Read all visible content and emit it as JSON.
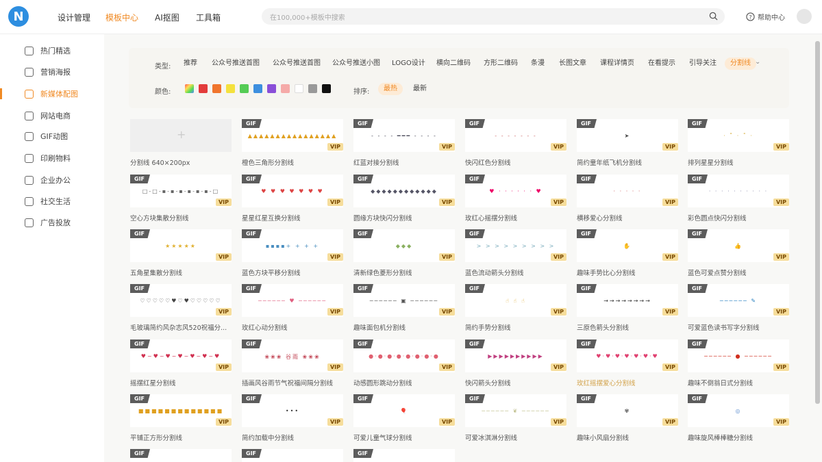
{
  "logo": {
    "letter": "N"
  },
  "nav": [
    {
      "label": "设计管理",
      "active": false
    },
    {
      "label": "模板中心",
      "active": true
    },
    {
      "label": "AI抠图",
      "active": false
    },
    {
      "label": "工具箱",
      "active": false
    }
  ],
  "search": {
    "placeholder": "在100,000+模板中搜索"
  },
  "help": {
    "label": "帮助中心"
  },
  "sidebar": [
    {
      "label": "热门精选",
      "icon": "flame-icon",
      "active": false
    },
    {
      "label": "营销海报",
      "icon": "poster-icon",
      "active": false
    },
    {
      "label": "新媒体配图",
      "icon": "chat-icon",
      "active": true
    },
    {
      "label": "网站电商",
      "icon": "store-icon",
      "active": false
    },
    {
      "label": "GIF动图",
      "icon": "gif-icon",
      "active": false
    },
    {
      "label": "印刷物料",
      "icon": "print-icon",
      "active": false
    },
    {
      "label": "企业办公",
      "icon": "briefcase-icon",
      "active": false
    },
    {
      "label": "社交生活",
      "icon": "cup-icon",
      "active": false
    },
    {
      "label": "广告投放",
      "icon": "ad-icon",
      "active": false
    }
  ],
  "filter": {
    "type_label": "类型:",
    "types": [
      "推荐",
      "公众号推送首图",
      "公众号推送首图",
      "公众号推送小图",
      "LOGO设计",
      "横向二维码",
      "方形二维码",
      "条漫",
      "长图文章",
      "课程详情页",
      "在看提示",
      "引导关注",
      "分割线"
    ],
    "selected_type": "分割线",
    "color_label": "颜色:",
    "colors": [
      "#6f6cf5",
      "#e33b3b",
      "#f0752d",
      "#f4e13d",
      "#55cc55",
      "#3d8fdf",
      "#8a4fd8",
      "#f5aaa8",
      "#ffffff",
      "#999999",
      "#111111"
    ],
    "sort_label": "排序:",
    "sorts": [
      "最热",
      "最新"
    ],
    "selected_sort": "最热"
  },
  "badges": {
    "gif": "GIF",
    "vip": "VIP"
  },
  "upload": {
    "label": "分割线 640×200px"
  },
  "templates": [
    {
      "title": "橙色三角形分割线",
      "deco": "▲▲▲▲▲▲▲▲▲▲▲▲▲▲▲▲",
      "color": "#e0a020"
    },
    {
      "title": "红蓝对接分割线",
      "deco": "- - - - ━━━ - - - -",
      "color": "#445"
    },
    {
      "title": "快闪红色分割线",
      "deco": "- - - - - - -",
      "color": "#c66"
    },
    {
      "title": "简约童年纸飞机分割线",
      "deco": "➤",
      "color": "#444"
    },
    {
      "title": "排列星星分割线",
      "deco": "· ˚ · ˚ ·",
      "color": "#d8b040"
    },
    {
      "title": "空心方块集散分割线",
      "deco": "□-□-▪-▪-▪-▪-▪-▪-□",
      "color": "#666"
    },
    {
      "title": "星星红星互换分割线",
      "deco": "♥ ♥ ♥ ♥ ♥ ♥ ♥",
      "color": "#d44"
    },
    {
      "title": "圆缘方块快闪分割线",
      "deco": "◆◆◆◆◆◆◆◆◆◆◆◆",
      "color": "#556"
    },
    {
      "title": "玫红心摇摆分割线",
      "deco": "♥ · · · · · · ♥",
      "color": "#e06"
    },
    {
      "title": "横移爱心分割线",
      "deco": "· · · · ·",
      "color": "#c55"
    },
    {
      "title": "彩色圆点快闪分割线",
      "deco": "· · · · · · · · · ·",
      "color": "#88a"
    },
    {
      "title": "五角星集散分割线",
      "deco": "★★★★★",
      "color": "#e0b030"
    },
    {
      "title": "蓝色方块平移分割线",
      "deco": "▪▪▪▪+ + +   +",
      "color": "#4a8fc0"
    },
    {
      "title": "清新绿色菱形分割线",
      "deco": "◆◆◆",
      "color": "#8ab060"
    },
    {
      "title": "蓝色流动箭头分割线",
      "deco": "> > > > > > > > >",
      "color": "#7ab"
    },
    {
      "title": "趣味手势比心分割线",
      "deco": "✋",
      "color": "#e8b090"
    },
    {
      "title": "蓝色可爱点赞分割线",
      "deco": "👍",
      "color": "#e0a030"
    },
    {
      "title": "毛玻璃简约风杂志风520祝福分...",
      "deco": "♡♡♡♡♡♥♡♥♡♡♡♡♡",
      "color": "#444"
    },
    {
      "title": "玫红心动分割线",
      "deco": "────── ♥ ──────",
      "color": "#e06080"
    },
    {
      "title": "趣味面包机分割线",
      "deco": "────── ▣ ──────",
      "color": "#555"
    },
    {
      "title": "简约手势分割线",
      "deco": "☝   ☝   ☝",
      "color": "#e0b040"
    },
    {
      "title": "三原色箭头分割线",
      "deco": "→→→→→→→→",
      "color": "#333"
    },
    {
      "title": "可爱蓝色读书写字分割线",
      "deco": "────── ✎",
      "color": "#2a80c0"
    },
    {
      "title": "摇摆红星分割线",
      "deco": "♥~♥~♥~♥~♥~♥~♥",
      "color": "#d03050"
    },
    {
      "title": "插画风谷雨节气祝福间隔分割线",
      "deco": "❀❀❀ 谷雨 ❀❀❀",
      "color": "#c04050"
    },
    {
      "title": "动感圆形跳动分割线",
      "deco": "●·●·●·●·●·●·●·●",
      "color": "#e06070"
    },
    {
      "title": "快闪箭头分割线",
      "deco": "▶▶▶▶▶▶▶▶▶▶",
      "color": "#c04080"
    },
    {
      "title": "玫红摇摆爱心分割线",
      "deco": "♥·♥·♥·♥·♥·♥·♥",
      "color": "#e04070",
      "highlight": true
    },
    {
      "title": "趣味不倒翁日式分割线",
      "deco": "────── ● ──────",
      "color": "#d03020"
    },
    {
      "title": "平铺正方形分割线",
      "deco": "■■■■■■■■■■■■■",
      "color": "#e0a020"
    },
    {
      "title": "简约加载中分割线",
      "deco": "•••",
      "color": "#333"
    },
    {
      "title": "可爱儿童气球分割线",
      "deco": "🎈",
      "color": "#7090c0"
    },
    {
      "title": "可爱冰淇淋分割线",
      "deco": "────── ❦ ──────",
      "color": "#c0c090"
    },
    {
      "title": "趣味小风扇分割线",
      "deco": "✾",
      "color": "#555"
    },
    {
      "title": "趣味旋风棒棒糖分割线",
      "deco": "◎",
      "color": "#6090d0"
    },
    {
      "title": "",
      "deco": "❦",
      "color": "#a05030"
    },
    {
      "title": "",
      "deco": "",
      "color": "#999"
    },
    {
      "title": "",
      "deco": "",
      "color": "#999"
    }
  ]
}
